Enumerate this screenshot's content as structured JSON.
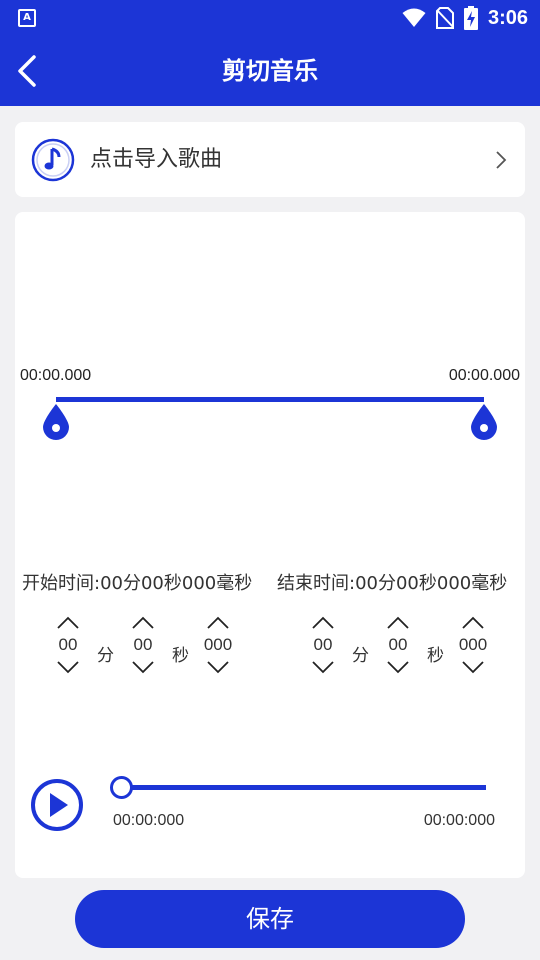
{
  "status_bar": {
    "app_icon_letter": "A",
    "time": "3:06",
    "icons": [
      "wifi-icon",
      "no-sim-icon",
      "battery-charging-icon"
    ]
  },
  "header": {
    "title": "剪切音乐",
    "back_icon": "chevron-left-icon"
  },
  "import_card": {
    "icon": "music-note-icon",
    "label": "点击导入歌曲",
    "chevron_icon": "chevron-right-icon"
  },
  "waveform": {
    "start_time": "00:00.000",
    "end_time": "00:00.000"
  },
  "start_time": {
    "label": "开始时间:00分00秒000毫秒",
    "minutes": "00",
    "minute_unit": "分",
    "seconds": "00",
    "second_unit": "秒",
    "millis": "000"
  },
  "end_time": {
    "label": "结束时间:00分00秒000毫秒",
    "minutes": "00",
    "minute_unit": "分",
    "seconds": "00",
    "second_unit": "秒",
    "millis": "000"
  },
  "player": {
    "current_time": "00:00:000",
    "total_time": "00:00:000",
    "progress": 0
  },
  "save_button": {
    "label": "保存"
  },
  "colors": {
    "accent": "#1c35d6",
    "background": "#f1f1f3",
    "card": "#ffffff"
  }
}
